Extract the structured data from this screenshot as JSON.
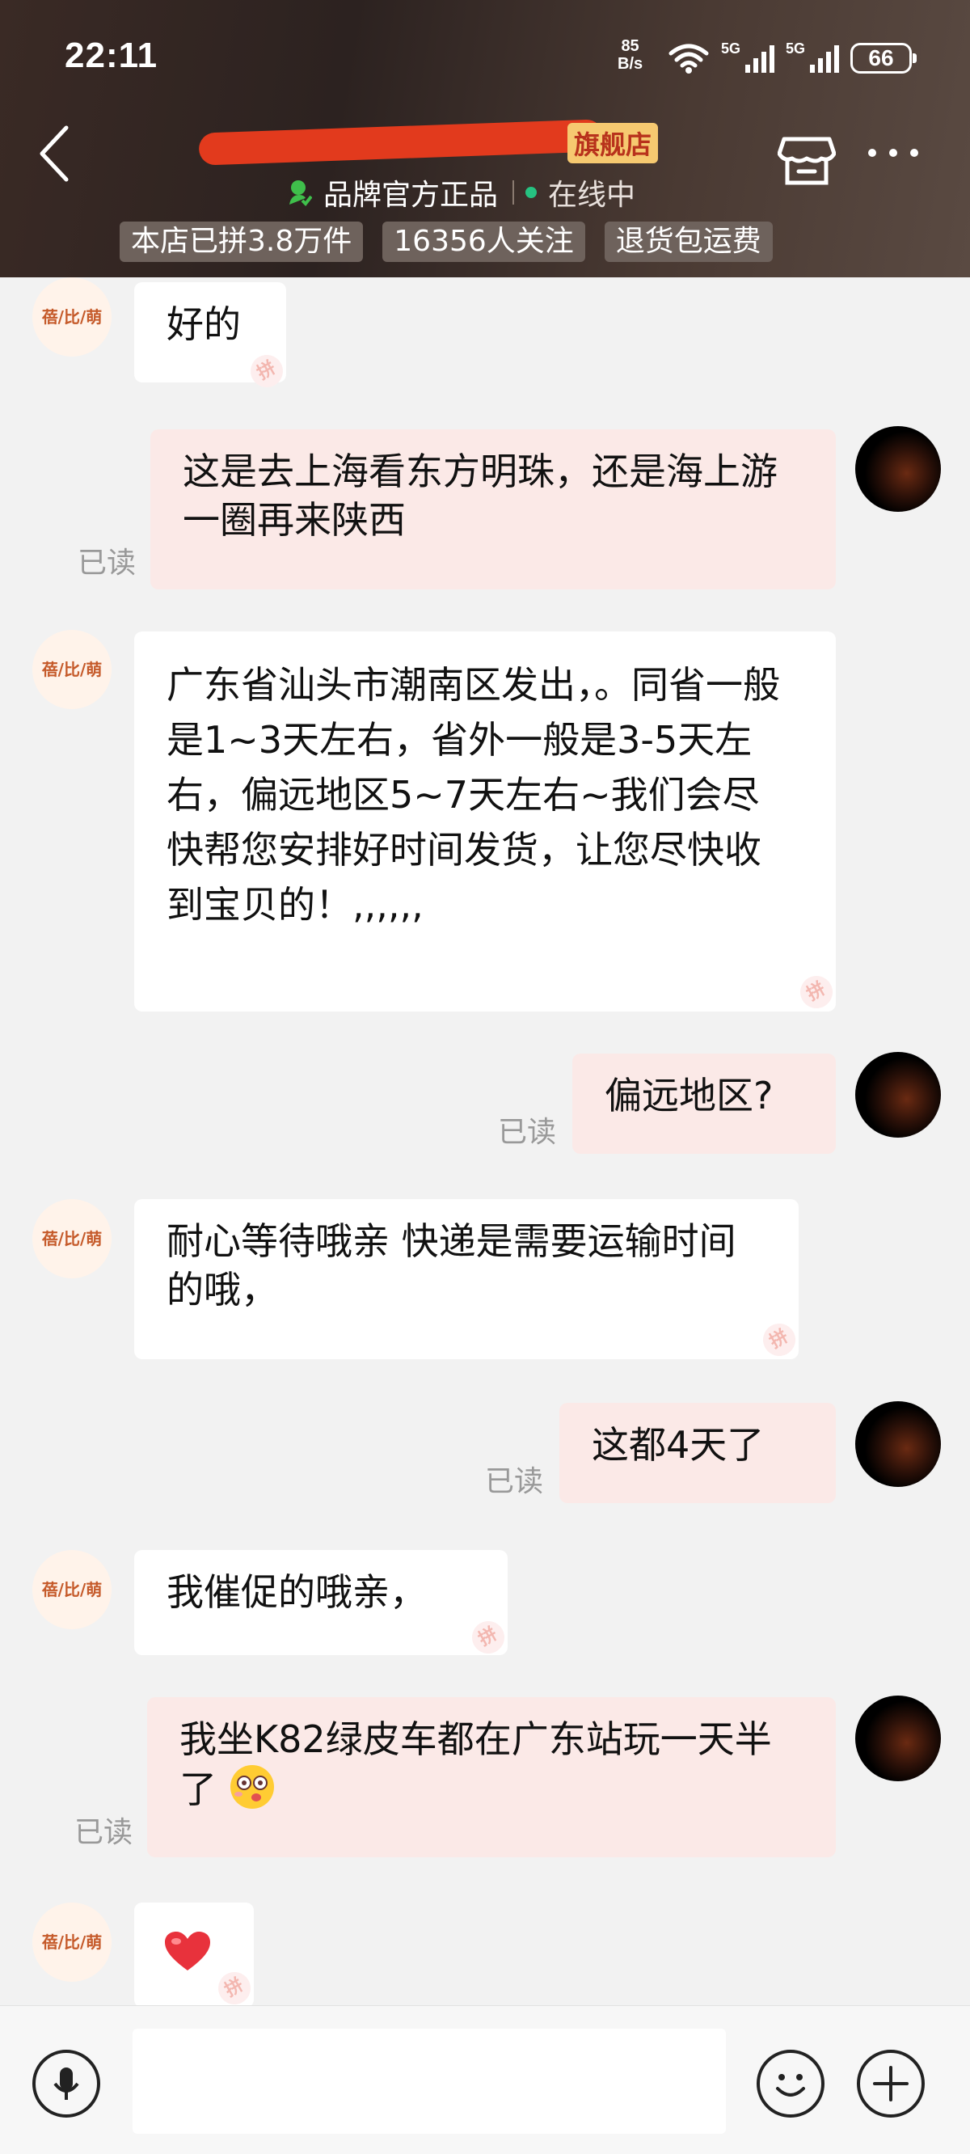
{
  "status_bar": {
    "time": "22:11",
    "net_speed_value": "85",
    "net_speed_unit": "B/s",
    "signal_1": "5G",
    "signal_2": "5G",
    "battery": "66"
  },
  "header": {
    "shop_suffix": "旗舰店",
    "official_badge": "品牌官方正品",
    "online_status": "在线中",
    "stats": [
      "本店已拼3.8万件",
      "16356人关注",
      "退货包运费"
    ]
  },
  "shop_avatar_text": "蓓/比/萌",
  "read_label": "已读",
  "messages": [
    {
      "side": "left",
      "text": "好的"
    },
    {
      "side": "right",
      "text": "这是去上海看东方明珠，还是海上游一圈再来陕西"
    },
    {
      "side": "left",
      "text": "广东省汕头市潮南区发出，。同省一般是1~3天左右，省外一般是3-5天左右，偏远地区5~7天左右~我们会尽快帮您安排好时间发货，让您尽快收到宝贝的！,,,,,,"
    },
    {
      "side": "right",
      "text": "偏远地区?"
    },
    {
      "side": "left",
      "text": "耐心等待哦亲  快递是需要运输时间的哦，"
    },
    {
      "side": "right",
      "text": "这都4天了"
    },
    {
      "side": "left",
      "text": "我催促的哦亲，"
    },
    {
      "side": "right",
      "text": "我坐K82绿皮车都在广东站玩一天半了"
    },
    {
      "side": "left",
      "text": ""
    }
  ],
  "pin_mark_text": "拼",
  "icons": {
    "back": "back-arrow-icon",
    "store": "store-icon",
    "more": "more-icon",
    "mic": "microphone-icon",
    "emoji": "emoji-icon",
    "plus": "plus-icon",
    "heart": "heart-icon",
    "dizzy": "dizzy-face-emoji"
  },
  "colors": {
    "header_bg": "#2c2220",
    "redaction": "#e23a1d",
    "user_bubble": "#fbe9e7",
    "shop_bubble": "#ffffff",
    "online_dot": "#26c281"
  }
}
